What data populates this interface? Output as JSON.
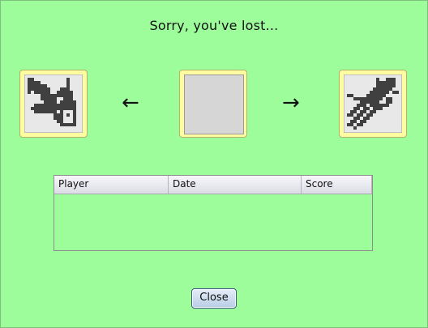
{
  "dialog": {
    "message": "Sorry, you've lost...",
    "arrow_left": "←",
    "arrow_right": "→",
    "close_label": "Close"
  },
  "pieces": {
    "left": "squirrel-with-disc-icon",
    "middle": "empty-tile",
    "right": "squid-icon"
  },
  "scores_table": {
    "columns": [
      "Player",
      "Date",
      "Score"
    ],
    "rows": []
  },
  "colors": {
    "background": "#9dfd9b",
    "tile_face": "#fdfca0",
    "pixel_dark": "#404040",
    "pixel_light": "#d6d6d6"
  }
}
